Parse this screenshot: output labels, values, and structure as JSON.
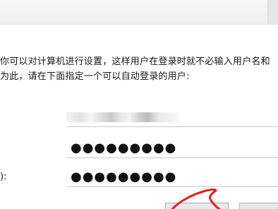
{
  "dialog": {
    "description_line1": "你可以对计算机进行设置，这样用户在登录时就不必输入用户名和",
    "description_line2": "为此，请在下面指定一个可以自动登录的用户:",
    "confirm_password_label": "):",
    "password_value": "●●●●●●●●●",
    "confirm_password_value": "●●●●●●●●●"
  }
}
